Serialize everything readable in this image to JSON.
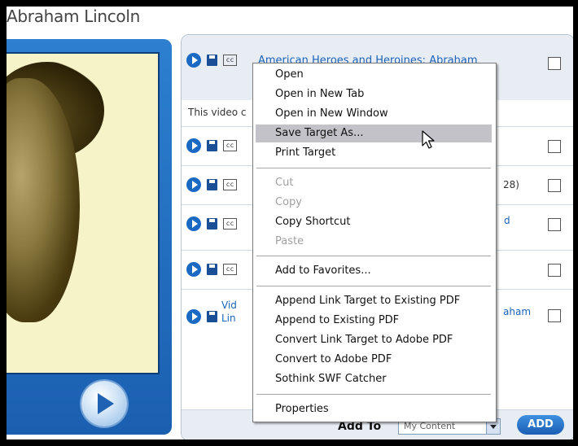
{
  "page": {
    "title": "Abraham Lincoln"
  },
  "list": {
    "header_title": "American Heroes and Heroines: Abraham",
    "description": "This video c",
    "cc_label": "cc",
    "rows": [
      {
        "text_fragment": ""
      },
      {
        "text_fragment": "28)"
      },
      {
        "link_fragment": "d"
      },
      {
        "text_fragment": ""
      },
      {
        "link_line1_left": "Vid",
        "link_line2_left": "Lin",
        "link_right": "aham"
      }
    ],
    "footer": {
      "add_to_label": "Add To",
      "select_value": "My Content",
      "add_button": "ADD"
    }
  },
  "context_menu": {
    "items": [
      {
        "label": "Open",
        "state": "normal"
      },
      {
        "label": "Open in New Tab",
        "state": "normal"
      },
      {
        "label": "Open in New Window",
        "state": "normal"
      },
      {
        "label": "Save Target As...",
        "state": "highlighted"
      },
      {
        "label": "Print Target",
        "state": "normal"
      },
      {
        "label": "Cut",
        "state": "disabled"
      },
      {
        "label": "Copy",
        "state": "disabled"
      },
      {
        "label": "Copy Shortcut",
        "state": "normal"
      },
      {
        "label": "Paste",
        "state": "disabled"
      },
      {
        "label": "Add to Favorites...",
        "state": "normal"
      },
      {
        "label": "Append Link Target to Existing PDF",
        "state": "normal"
      },
      {
        "label": "Append to Existing PDF",
        "state": "normal"
      },
      {
        "label": "Convert Link Target to Adobe PDF",
        "state": "normal"
      },
      {
        "label": "Convert to Adobe PDF",
        "state": "normal"
      },
      {
        "label": "Sothink SWF Catcher",
        "state": "normal"
      },
      {
        "label": "Properties",
        "state": "normal"
      }
    ]
  },
  "colors": {
    "accent_blue": "#1b63b8",
    "panel_blue": "#2d7fd0",
    "menu_highlight": "#c2c2c8"
  },
  "icons": [
    "play-icon",
    "save-icon",
    "closed-caption-icon",
    "checkbox",
    "arrow-cursor"
  ]
}
